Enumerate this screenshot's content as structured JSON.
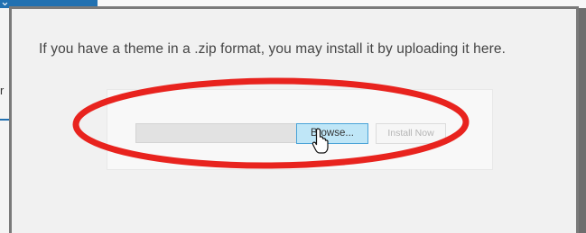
{
  "upload": {
    "help_text": "If you have a theme in a .zip format, you may install it by uploading it here.",
    "browse_label": "Browse...",
    "install_label": "Install Now"
  },
  "background": {
    "partial_letter": "r"
  },
  "colors": {
    "annotation": "#e8231e",
    "browse_highlight": "#bfe6f7",
    "accent": "#2271b1"
  },
  "icons": {
    "collapse": "chevron-down-icon",
    "cursor": "hand-pointer-icon"
  }
}
